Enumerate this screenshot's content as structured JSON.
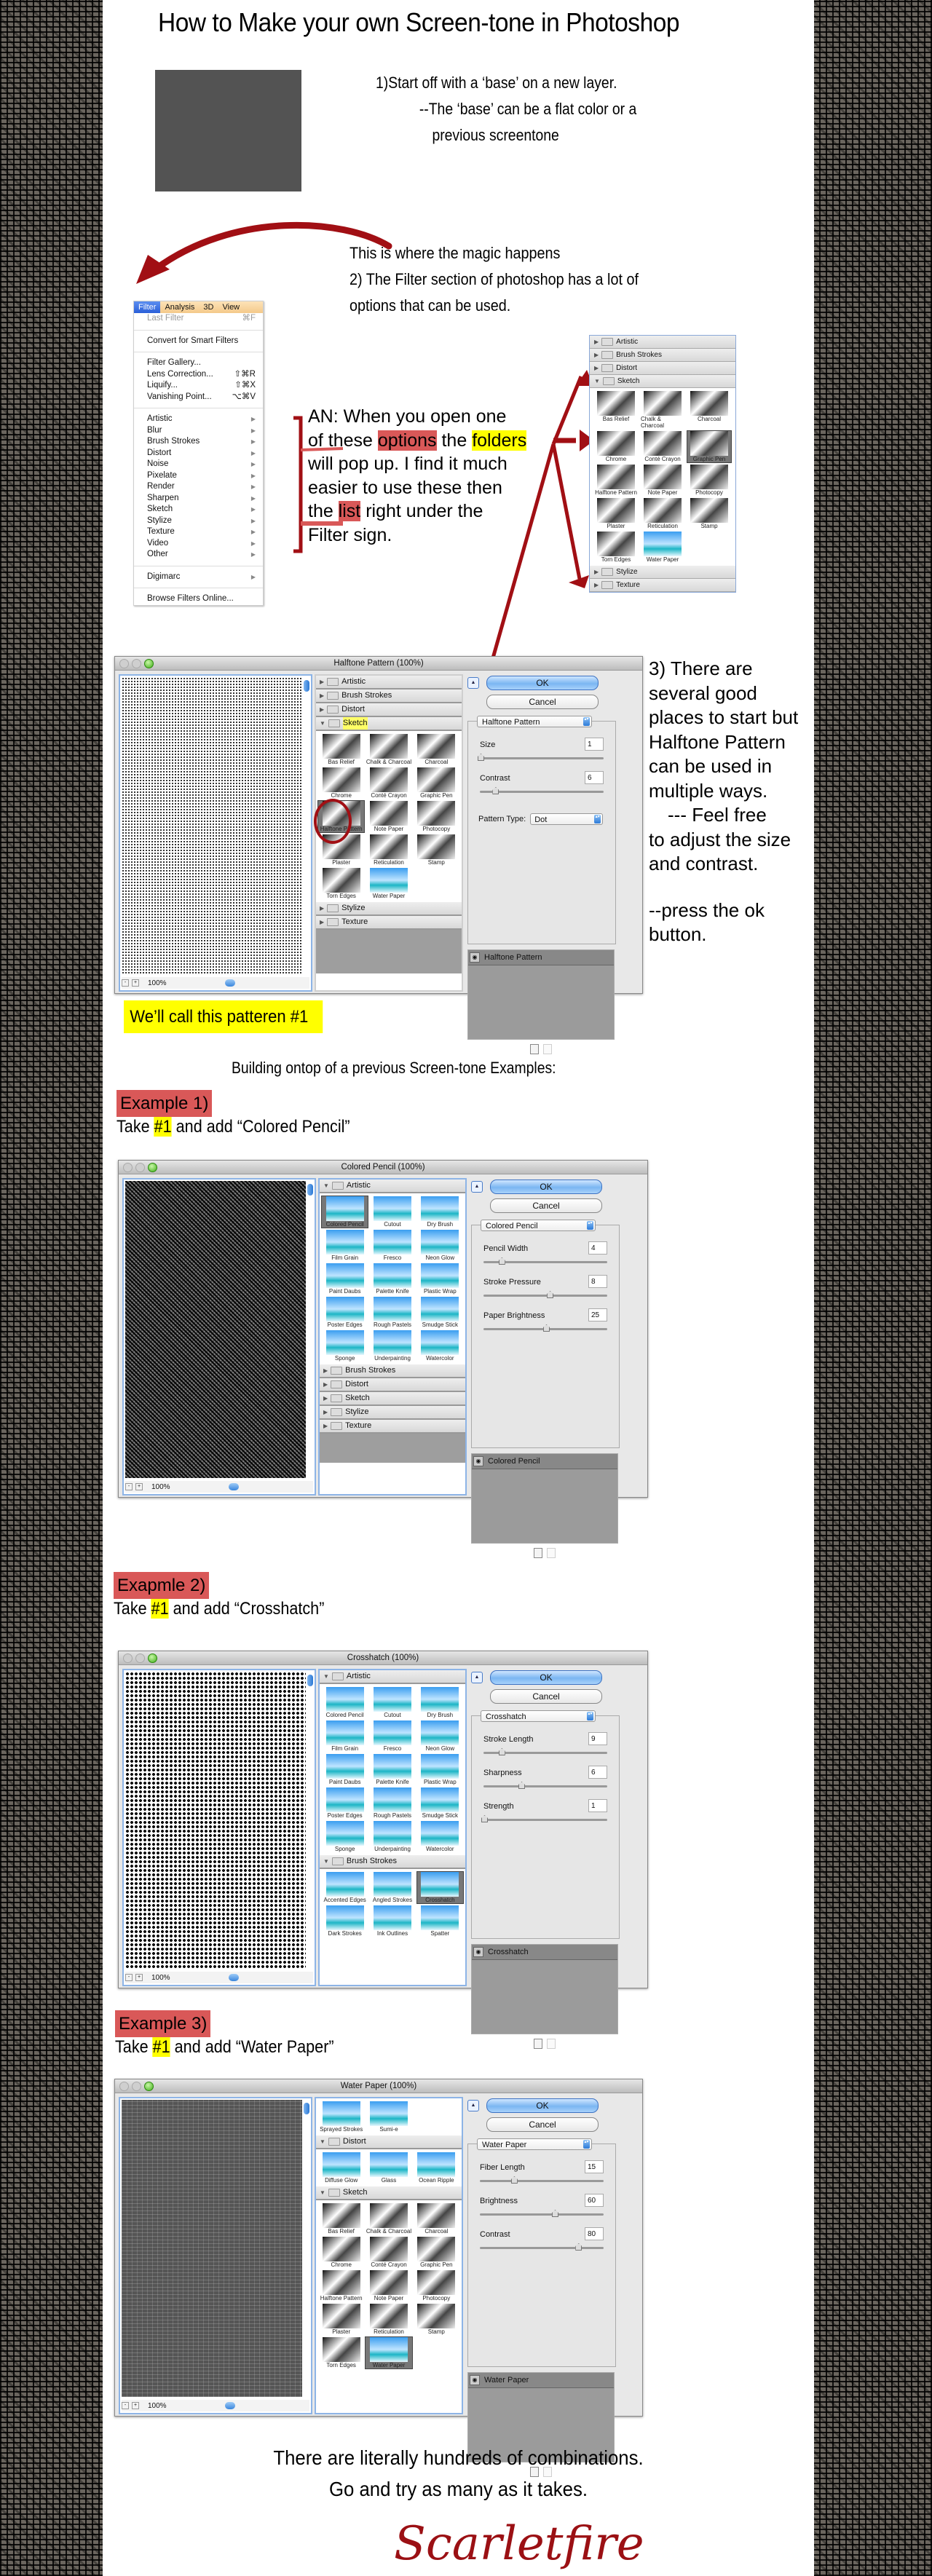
{
  "title": "How to Make your own Screen-tone in Photoshop",
  "step1": {
    "lines": [
      "1)Start off with a ‘base’ on a new layer.",
      "--The ‘base’ can be a flat color or a",
      "previous screentone"
    ],
    "swatch_color": "#535353"
  },
  "step2": {
    "lines": [
      "This is where the magic happens",
      "2) The Filter section of photoshop has a lot of",
      "options that can be used."
    ]
  },
  "filter_menu": {
    "menubar": [
      "Filter",
      "Analysis",
      "3D",
      "View"
    ],
    "groups": [
      [
        {
          "label": "Last Filter",
          "shortcut": "⌘F",
          "disabled": true
        }
      ],
      [
        {
          "label": "Convert for Smart Filters",
          "shortcut": ""
        }
      ],
      [
        {
          "label": "Filter Gallery...",
          "shortcut": ""
        },
        {
          "label": "Lens Correction...",
          "shortcut": "⇧⌘R"
        },
        {
          "label": "Liquify...",
          "shortcut": "⇧⌘X"
        },
        {
          "label": "Vanishing Point...",
          "shortcut": "⌥⌘V"
        }
      ],
      [
        {
          "label": "Artistic",
          "submenu": true
        },
        {
          "label": "Blur",
          "submenu": true
        },
        {
          "label": "Brush Strokes",
          "submenu": true
        },
        {
          "label": "Distort",
          "submenu": true
        },
        {
          "label": "Noise",
          "submenu": true
        },
        {
          "label": "Pixelate",
          "submenu": true
        },
        {
          "label": "Render",
          "submenu": true
        },
        {
          "label": "Sharpen",
          "submenu": true
        },
        {
          "label": "Sketch",
          "submenu": true
        },
        {
          "label": "Stylize",
          "submenu": true
        },
        {
          "label": "Texture",
          "submenu": true
        },
        {
          "label": "Video",
          "submenu": true
        },
        {
          "label": "Other",
          "submenu": true
        }
      ],
      [
        {
          "label": "Digimarc",
          "submenu": true
        }
      ],
      [
        {
          "label": "Browse Filters Online...",
          "shortcut": ""
        }
      ]
    ]
  },
  "author_note": {
    "line1": "AN: When you open one",
    "line2_pre": "of these ",
    "line2_hl1": "options",
    "line2_mid": " the ",
    "line2_hl2": "folders",
    "line3": "will pop up. I find it much",
    "line4": "easier to use these then",
    "line5_pre": "the ",
    "line5_hl": "list",
    "line5_post": " right under the",
    "line6": "Filter sign."
  },
  "sketch_panel": {
    "folders_top": [
      "Artistic",
      "Brush Strokes",
      "Distort"
    ],
    "open_folder": "Sketch",
    "items": [
      "Bas Relief",
      "Chalk & Charcoal",
      "Charcoal",
      "Chrome",
      "Conté Crayon",
      "Graphic Pen",
      "Halftone Pattern",
      "Note Paper",
      "Photocopy",
      "Plaster",
      "Reticulation",
      "Stamp",
      "Torn Edges",
      "Water Paper"
    ],
    "selected": "Graphic Pen",
    "folders_bottom": [
      "Stylize",
      "Texture"
    ]
  },
  "step3": {
    "lines": [
      "3) There are",
      "several good",
      "places to start but",
      "Halftone Pattern",
      "can be used in",
      "multiple ways.",
      "--- Feel free",
      "to adjust the size",
      "and contrast.",
      "--press the ok",
      "button."
    ]
  },
  "dialogs": {
    "halftone": {
      "title": "Halftone Pattern (100%)",
      "zoom": "100%",
      "ok": "OK",
      "cancel": "Cancel",
      "folders_top": [
        "Artistic",
        "Brush Strokes",
        "Distort"
      ],
      "open_folder": "Sketch",
      "items": [
        "Bas Relief",
        "Chalk & Charcoal",
        "Charcoal",
        "Chrome",
        "Conté Crayon",
        "Graphic Pen",
        "Halftone Pattern",
        "Note Paper",
        "Photocopy",
        "Plaster",
        "Reticulation",
        "Stamp",
        "Torn Edges",
        "Water Paper"
      ],
      "selected": "Halftone Pattern",
      "folders_bottom": [
        "Stylize",
        "Texture"
      ],
      "filter_select": "Halftone Pattern",
      "params": [
        {
          "label": "Size",
          "value": "1",
          "fraction": 0.0
        },
        {
          "label": "Contrast",
          "value": "6",
          "fraction": 0.12
        }
      ],
      "pattern_type_label": "Pattern Type:",
      "pattern_type": "Dot",
      "layer": "Halftone Pattern"
    },
    "colored_pencil": {
      "title": "Colored Pencil (100%)",
      "zoom": "100%",
      "ok": "OK",
      "cancel": "Cancel",
      "open_folder": "Artistic",
      "items": [
        "Colored Pencil",
        "Cutout",
        "Dry Brush",
        "Film Grain",
        "Fresco",
        "Neon Glow",
        "Paint Daubs",
        "Palette Knife",
        "Plastic Wrap",
        "Poster Edges",
        "Rough Pastels",
        "Smudge Stick",
        "Sponge",
        "Underpainting",
        "Watercolor"
      ],
      "selected": "Colored Pencil",
      "folders_bottom": [
        "Brush Strokes",
        "Distort",
        "Sketch",
        "Stylize",
        "Texture"
      ],
      "filter_select": "Colored Pencil",
      "params": [
        {
          "label": "Pencil Width",
          "value": "4",
          "fraction": 0.14
        },
        {
          "label": "Stroke Pressure",
          "value": "8",
          "fraction": 0.53
        },
        {
          "label": "Paper Brightness",
          "value": "25",
          "fraction": 0.5
        }
      ],
      "layer": "Colored Pencil"
    },
    "crosshatch": {
      "title": "Crosshatch (100%)",
      "zoom": "100%",
      "ok": "OK",
      "cancel": "Cancel",
      "open_folder": "Artistic",
      "items": [
        "Colored Pencil",
        "Cutout",
        "Dry Brush",
        "Film Grain",
        "Fresco",
        "Neon Glow",
        "Paint Daubs",
        "Palette Knife",
        "Plastic Wrap",
        "Poster Edges",
        "Rough Pastels",
        "Smudge Stick",
        "Sponge",
        "Underpainting",
        "Watercolor"
      ],
      "open_folder2": "Brush Strokes",
      "items2": [
        "Accented Edges",
        "Angled Strokes",
        "Crosshatch",
        "Dark Strokes",
        "Ink Outlines",
        "Spatter"
      ],
      "selected": "Crosshatch",
      "filter_select": "Crosshatch",
      "params": [
        {
          "label": "Stroke Length",
          "value": "9",
          "fraction": 0.14
        },
        {
          "label": "Sharpness",
          "value": "6",
          "fraction": 0.3
        },
        {
          "label": "Strength",
          "value": "1",
          "fraction": 0.0
        }
      ],
      "layer": "Crosshatch"
    },
    "water_paper": {
      "title": "Water Paper (100%)",
      "zoom": "100%",
      "ok": "OK",
      "cancel": "Cancel",
      "top_items": [
        "Sprayed Strokes",
        "Sumi-e"
      ],
      "open_folder": "Distort",
      "items": [
        "Diffuse Glow",
        "Glass",
        "Ocean Ripple"
      ],
      "open_folder2": "Sketch",
      "items2": [
        "Bas Relief",
        "Chalk & Charcoal",
        "Charcoal",
        "Chrome",
        "Conté Crayon",
        "Graphic Pen",
        "Halftone Pattern",
        "Note Paper",
        "Photocopy",
        "Plaster",
        "Reticulation",
        "Stamp",
        "Torn Edges",
        "Water Paper"
      ],
      "selected": "Water Paper",
      "filter_select": "Water Paper",
      "params": [
        {
          "label": "Fiber Length",
          "value": "15",
          "fraction": 0.27
        },
        {
          "label": "Brightness",
          "value": "60",
          "fraction": 0.6
        },
        {
          "label": "Contrast",
          "value": "80",
          "fraction": 0.79
        }
      ],
      "layer": "Water Paper"
    }
  },
  "pattern_note": "We’ll call this patteren #1",
  "building_heading": "Building ontop of a previous Screen-tone Examples:",
  "examples": [
    {
      "label": "Example 1)",
      "take_pre": "Take ",
      "ref": "#1",
      "take_post": " and add “Colored Pencil”"
    },
    {
      "label": "Exapmle 2)",
      "take_pre": "Take ",
      "ref": "#1",
      "take_post": " and  add “Crosshatch”"
    },
    {
      "label": "Example 3)",
      "take_pre": "Take ",
      "ref": "#1",
      "take_post": " and add “Water Paper”"
    }
  ],
  "closing": [
    "There are literally hundreds of combinations.",
    "Go and try as many as it takes."
  ],
  "signature": "Scarletfire",
  "colors": {
    "accent_red": "#a10f14",
    "highlight_red": "#d95858",
    "highlight_yellow": "#ffff00"
  }
}
